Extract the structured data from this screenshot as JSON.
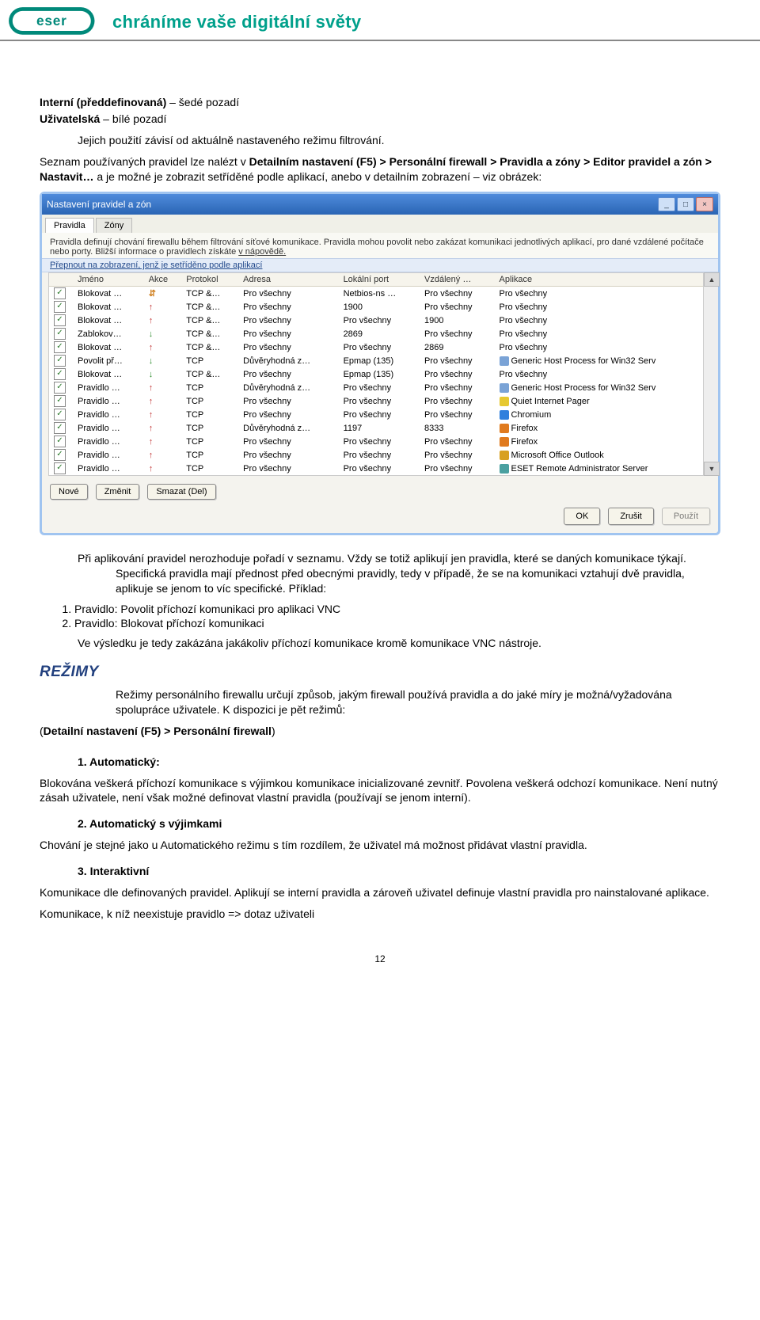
{
  "header": {
    "tagline": "chráníme vaše digitální světy"
  },
  "logoText": "eser",
  "intro": {
    "line1_strong": "Interní (předdefinovaná)",
    "line1_rest": " – šedé pozadí",
    "line2_strong": "Uživatelská",
    "line2_rest": " – bílé pozadí",
    "p2": "Jejich použití závisí od aktuálně nastaveného režimu filtrování.",
    "p3a": "Seznam používaných pravidel lze nalézt v ",
    "p3b": "Detailním nastavení (F5) > Personální firewall > Pravidla a zóny > Editor pravidel a zón > Nastavit…",
    "p3c": " a je možné je zobrazit setříděné podle aplikací, anebo v detailním zobrazení – viz obrázek:"
  },
  "dialog": {
    "title": "Nastavení pravidel a zón",
    "tabs": [
      "Pravidla",
      "Zóny"
    ],
    "descr": "Pravidla definují chování firewallu během filtrování síťové komunikace. Pravidla mohou povolit nebo zakázat komunikaci jednotlivých aplikací, pro dané vzdálené počítače nebo porty. Bližší informace o pravidlech získáte ",
    "helpLink": "v nápovědě.",
    "switch": "Přepnout na zobrazení, jenž je setříděno podle aplikací",
    "cols": [
      "Jméno",
      "Akce",
      "Protokol",
      "Adresa",
      "Lokální port",
      "Vzdálený …",
      "Aplikace"
    ],
    "rows": [
      {
        "name": "Blokovat …",
        "dir": "both",
        "proto": "TCP &…",
        "addr": "Pro všechny",
        "lp": "Netbios-ns …",
        "rp": "Pro všechny",
        "app": "Pro všechny",
        "ico": ""
      },
      {
        "name": "Blokovat …",
        "dir": "up",
        "proto": "TCP &…",
        "addr": "Pro všechny",
        "lp": "1900",
        "rp": "Pro všechny",
        "app": "Pro všechny",
        "ico": ""
      },
      {
        "name": "Blokovat …",
        "dir": "up",
        "proto": "TCP &…",
        "addr": "Pro všechny",
        "lp": "Pro všechny",
        "rp": "1900",
        "app": "Pro všechny",
        "ico": ""
      },
      {
        "name": "Zablokov…",
        "dir": "down",
        "proto": "TCP &…",
        "addr": "Pro všechny",
        "lp": "2869",
        "rp": "Pro všechny",
        "app": "Pro všechny",
        "ico": ""
      },
      {
        "name": "Blokovat …",
        "dir": "up",
        "proto": "TCP &…",
        "addr": "Pro všechny",
        "lp": "Pro všechny",
        "rp": "2869",
        "app": "Pro všechny",
        "ico": ""
      },
      {
        "name": "Povolit př…",
        "dir": "down",
        "proto": "TCP",
        "addr": "Důvěryhodná z…",
        "lp": "Epmap (135)",
        "rp": "Pro všechny",
        "app": "Generic Host Process for Win32 Serv",
        "ico": "#7aa3d6"
      },
      {
        "name": "Blokovat …",
        "dir": "down",
        "proto": "TCP &…",
        "addr": "Pro všechny",
        "lp": "Epmap (135)",
        "rp": "Pro všechny",
        "app": "Pro všechny",
        "ico": ""
      },
      {
        "name": "Pravidlo …",
        "dir": "up",
        "proto": "TCP",
        "addr": "Důvěryhodná z…",
        "lp": "Pro všechny",
        "rp": "Pro všechny",
        "app": "Generic Host Process for Win32 Serv",
        "ico": "#7aa3d6"
      },
      {
        "name": "Pravidlo …",
        "dir": "up",
        "proto": "TCP",
        "addr": "Pro všechny",
        "lp": "Pro všechny",
        "rp": "Pro všechny",
        "app": "Quiet Internet Pager",
        "ico": "#e6c830"
      },
      {
        "name": "Pravidlo …",
        "dir": "up",
        "proto": "TCP",
        "addr": "Pro všechny",
        "lp": "Pro všechny",
        "rp": "Pro všechny",
        "app": "Chromium",
        "ico": "#3080dd"
      },
      {
        "name": "Pravidlo …",
        "dir": "up",
        "proto": "TCP",
        "addr": "Důvěryhodná z…",
        "lp": "1197",
        "rp": "8333",
        "app": "Firefox",
        "ico": "#e07a1e"
      },
      {
        "name": "Pravidlo …",
        "dir": "up",
        "proto": "TCP",
        "addr": "Pro všechny",
        "lp": "Pro všechny",
        "rp": "Pro všechny",
        "app": "Firefox",
        "ico": "#e07a1e"
      },
      {
        "name": "Pravidlo …",
        "dir": "up",
        "proto": "TCP",
        "addr": "Pro všechny",
        "lp": "Pro všechny",
        "rp": "Pro všechny",
        "app": "Microsoft Office Outlook",
        "ico": "#d8a020"
      },
      {
        "name": "Pravidlo …",
        "dir": "up",
        "proto": "TCP",
        "addr": "Pro všechny",
        "lp": "Pro všechny",
        "rp": "Pro všechny",
        "app": "ESET Remote Administrator Server",
        "ico": "#4aa0a0"
      }
    ],
    "btns": {
      "new": "Nové",
      "edit": "Změnit",
      "del": "Smazat (Del)",
      "ok": "OK",
      "cancel": "Zrušit",
      "apply": "Použít"
    }
  },
  "after": {
    "p1": "Při aplikování pravidel nerozhoduje pořadí v seznamu. Vždy se totiž aplikují jen pravidla, které se daných komunikace týkají. Specifická pravidla mají přednost před obecnými pravidly, tedy v případě, že se na komunikaci vztahují dvě pravidla, aplikuje se jenom to víc specifické. Příklad:",
    "li1": "Pravidlo: Povolit příchozí komunikaci pro aplikaci VNC",
    "li2": "Pravidlo: Blokovat příchozí komunikaci",
    "p2": "Ve výsledku je tedy zakázána jakákoliv příchozí komunikace kromě komunikace VNC nástroje."
  },
  "regimy": {
    "title": "REŽIMY",
    "p1": "Režimy personálního firewallu určují způsob, jakým firewall používá pravidla a do jaké míry je možná/vyžadována spolupráce uživatele. K dispozici je pět režimů:",
    "path": "(Detailní nastavení (F5) > Personální firewall)",
    "m1t": "1.    Automatický:",
    "m1b": "Blokována veškerá příchozí komunikace s výjimkou komunikace inicializované zevnitř.  Povolena veškerá odchozí komunikace. Není nutný zásah uživatele, není však možné definovat vlastní pravidla (používají se jenom interní).",
    "m2t": "2.    Automatický s výjimkami",
    "m2b": "Chování je stejné jako u Automatického režimu s tím rozdílem, že uživatel má možnost přidávat vlastní pravidla.",
    "m3t": "3.    Interaktivní",
    "m3b": "Komunikace dle definovaných pravidel. Aplikují se interní pravidla a zároveň uživatel definuje vlastní pravidla pro nainstalované aplikace.",
    "m3c": "Komunikace, k níž neexistuje pravidlo => dotaz uživateli"
  },
  "pageNumber": "12"
}
